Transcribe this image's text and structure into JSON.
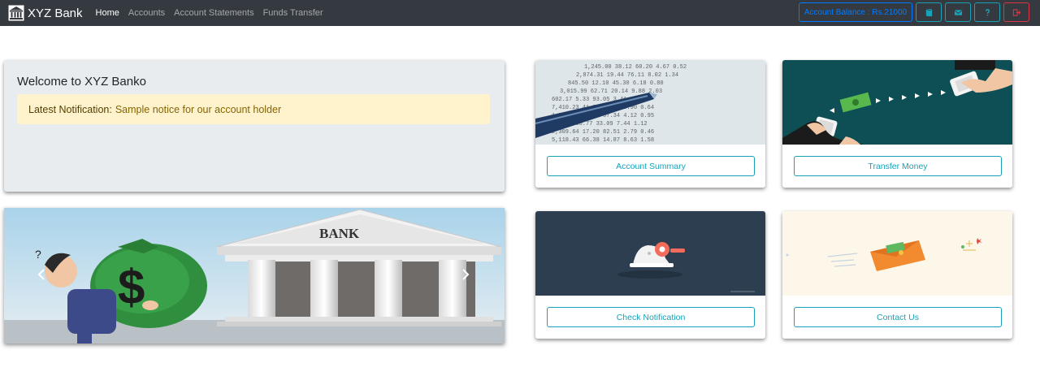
{
  "navbar": {
    "brand": "XYZ Bank",
    "links": [
      "Home",
      "Accounts",
      "Account Statements",
      "Funds Transfer"
    ],
    "active_link": "Home",
    "balance_label": "Account Balance : Rs.21000",
    "icon_buttons": [
      "book-icon",
      "envelope-icon",
      "question-icon",
      "sign-out-icon"
    ]
  },
  "welcome": {
    "title": "Welcome to XYZ Banko",
    "notice_label": "Latest Notification:",
    "notice_text": "Sample notice for our account holder"
  },
  "carousel": {
    "sign_text": "BANK"
  },
  "cards": [
    {
      "button": "Account Summary",
      "image": "financial-ledger-pen"
    },
    {
      "button": "Transfer Money",
      "image": "phone-money-transfer"
    },
    {
      "button": "Check Notification",
      "image": "notification-bell"
    },
    {
      "button": "Contact Us",
      "image": "envelope-money"
    }
  ],
  "colors": {
    "navbar_bg": "#343a40",
    "info": "#17a2b8",
    "primary": "#007bff",
    "danger": "#dc3545",
    "jumbotron_bg": "#e9ecef",
    "alert_bg": "#fff3cd"
  }
}
